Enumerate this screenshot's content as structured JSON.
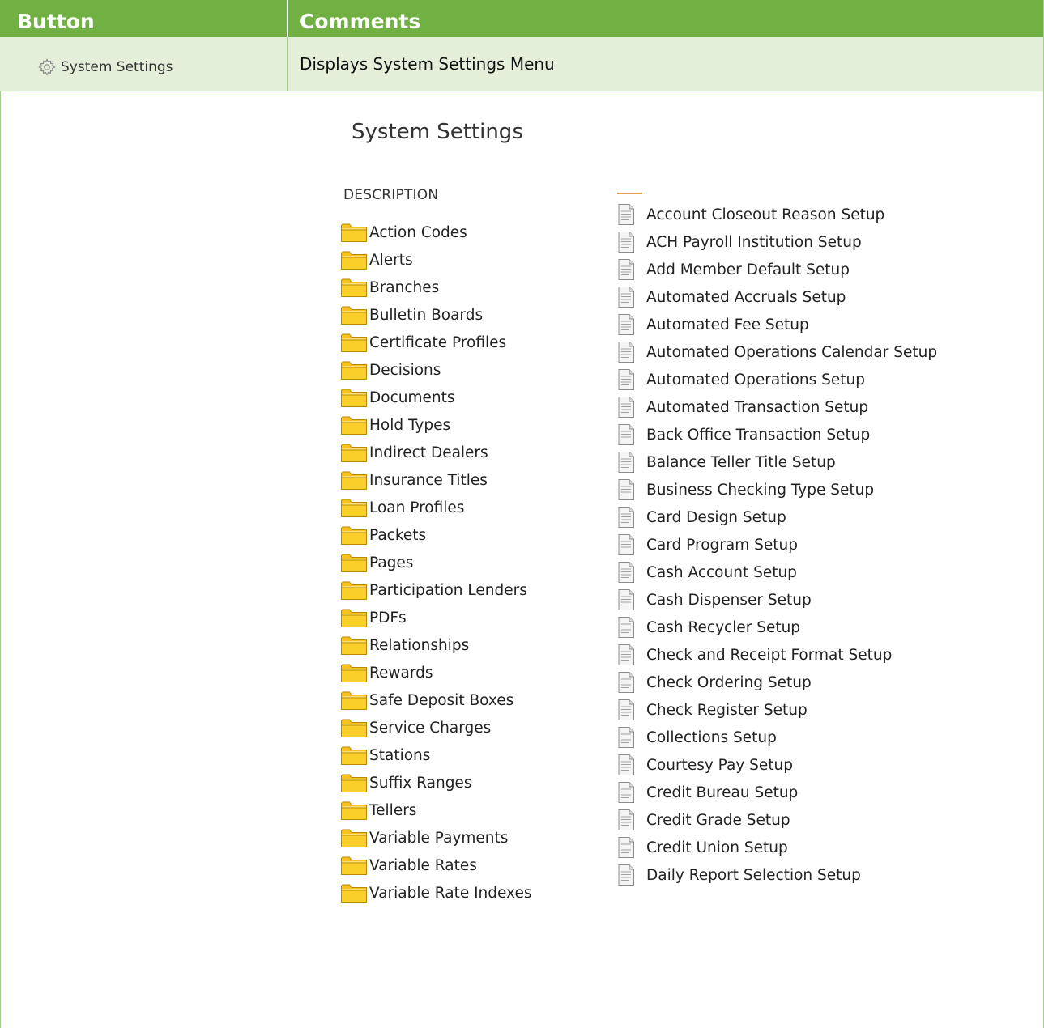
{
  "table": {
    "header": {
      "button": "Button",
      "comments": "Comments"
    },
    "row": {
      "button_icon": "gear-icon",
      "button_label": "System Settings",
      "comment": "Displays System Settings Menu"
    },
    "colors": {
      "header_bg": "#71b144",
      "row_bg": "#e3efd9",
      "border": "#a8d08d"
    }
  },
  "menu": {
    "title": "System Settings",
    "column_header": "DESCRIPTION",
    "folder_icon": "folder-icon",
    "document_icon": "document-icon",
    "folders": [
      "Action Codes",
      "Alerts",
      "Branches",
      "Bulletin Boards",
      "Certificate Profiles",
      "Decisions",
      "Documents",
      "Hold Types",
      "Indirect Dealers",
      "Insurance Titles",
      "Loan Profiles",
      "Packets",
      "Pages",
      "Participation Lenders",
      "PDFs",
      "Relationships",
      "Rewards",
      "Safe Deposit Boxes",
      "Service Charges",
      "Stations",
      "Suffix Ranges",
      "Tellers",
      "Variable Payments",
      "Variable Rates",
      "Variable Rate Indexes"
    ],
    "setups": [
      "Account Closeout Reason Setup",
      "ACH Payroll Institution Setup",
      "Add Member Default Setup",
      "Automated Accruals Setup",
      "Automated Fee Setup",
      "Automated Operations Calendar Setup",
      "Automated Operations Setup",
      "Automated Transaction Setup",
      "Back Office Transaction Setup",
      "Balance Teller Title Setup",
      "Business Checking Type Setup",
      "Card Design Setup",
      "Card Program Setup",
      "Cash Account Setup",
      "Cash Dispenser Setup",
      "Cash Recycler Setup",
      "Check and Receipt Format Setup",
      "Check Ordering Setup",
      "Check Register Setup",
      "Collections Setup",
      "Courtesy Pay Setup",
      "Credit Bureau Setup",
      "Credit Grade Setup",
      "Credit Union Setup",
      "Daily Report Selection Setup"
    ]
  }
}
